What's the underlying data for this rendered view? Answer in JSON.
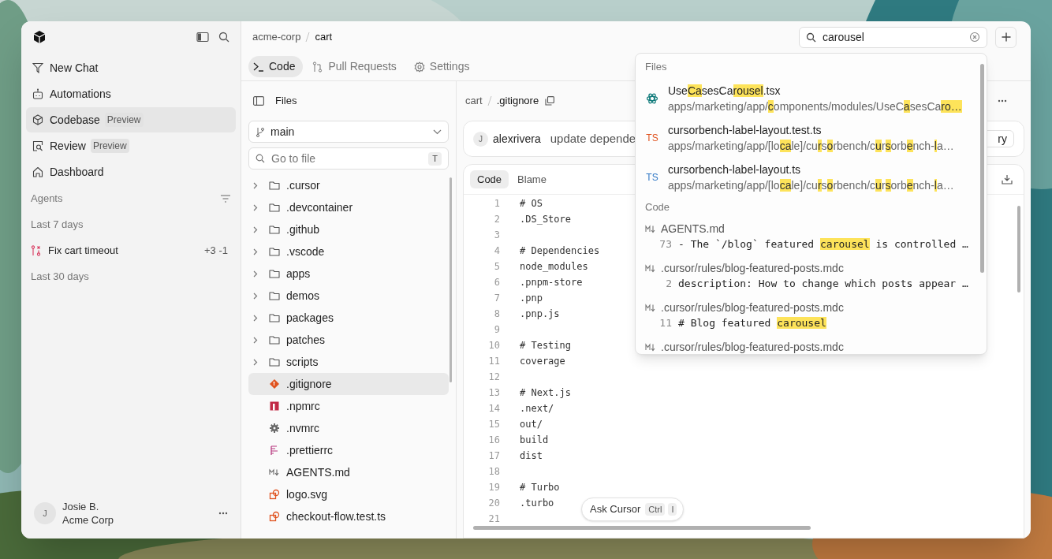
{
  "sidebar": {
    "nav": [
      {
        "label": "New Chat",
        "selected": false
      },
      {
        "label": "Automations",
        "selected": false
      },
      {
        "label": "Codebase",
        "badge": "Preview",
        "selected": true
      },
      {
        "label": "Review",
        "badge": "Preview",
        "selected": false
      },
      {
        "label": "Dashboard",
        "selected": false
      }
    ],
    "agents_heading": "Agents",
    "groups": [
      {
        "label": "Last 7 days",
        "items": [
          {
            "title": "Fix cart timeout",
            "diff": "+3 -1"
          }
        ]
      },
      {
        "label": "Last 30 days"
      }
    ],
    "user": {
      "initial": "J",
      "name": "Josie B.",
      "org": "Acme Corp"
    }
  },
  "breadcrumb": [
    "acme-corp",
    "cart"
  ],
  "tabs": [
    {
      "label": "Code",
      "selected": true
    },
    {
      "label": "Pull Requests",
      "selected": false
    },
    {
      "label": "Settings",
      "selected": false
    }
  ],
  "search": {
    "value": "carousel"
  },
  "files_panel": {
    "title": "Files",
    "branch": "main",
    "filter_placeholder": "Go to file",
    "shortcut": "T",
    "items": [
      {
        "kind": "folder",
        "name": ".cursor"
      },
      {
        "kind": "folder",
        "name": ".devcontainer"
      },
      {
        "kind": "folder",
        "name": ".github"
      },
      {
        "kind": "folder",
        "name": ".vscode"
      },
      {
        "kind": "folder",
        "name": "apps"
      },
      {
        "kind": "folder",
        "name": "demos"
      },
      {
        "kind": "folder",
        "name": "packages"
      },
      {
        "kind": "folder",
        "name": "patches"
      },
      {
        "kind": "folder",
        "name": "scripts"
      },
      {
        "kind": "git",
        "name": ".gitignore",
        "selected": true
      },
      {
        "kind": "npm",
        "name": ".npmrc",
        "selected": false
      },
      {
        "kind": "config",
        "name": ".nvmrc",
        "selected": false
      },
      {
        "kind": "prettier",
        "name": ".prettierrc",
        "selected": false
      },
      {
        "kind": "markdown",
        "name": "AGENTS.md",
        "selected": false
      },
      {
        "kind": "svg",
        "name": "logo.svg",
        "selected": false
      },
      {
        "kind": "svg",
        "name": "checkout-flow.test.ts",
        "selected": false
      }
    ]
  },
  "viewer": {
    "path": [
      "cart",
      ".gitignore"
    ],
    "commit": {
      "initial": "J",
      "author": "alexrivera",
      "message": "update depende",
      "button": "ry"
    },
    "modes": [
      {
        "label": "Code",
        "selected": true
      },
      {
        "label": "Blame",
        "selected": false
      }
    ],
    "lines": [
      {
        "n": "1",
        "text": "# OS"
      },
      {
        "n": "2",
        "text": ".DS_Store"
      },
      {
        "n": "3"
      },
      {
        "n": "4",
        "text": "# Dependencies"
      },
      {
        "n": "5",
        "text": "node_modules"
      },
      {
        "n": "6",
        "text": ".pnpm-store"
      },
      {
        "n": "7",
        "text": ".pnp"
      },
      {
        "n": "8",
        "text": ".pnp.js"
      },
      {
        "n": "9"
      },
      {
        "n": "10",
        "text": "# Testing"
      },
      {
        "n": "11",
        "text": "coverage"
      },
      {
        "n": "12"
      },
      {
        "n": "13",
        "text": "# Next.js"
      },
      {
        "n": "14",
        "text": ".next/"
      },
      {
        "n": "15",
        "text": "out/"
      },
      {
        "n": "16",
        "text": "build"
      },
      {
        "n": "17",
        "text": "dist"
      },
      {
        "n": "18"
      },
      {
        "n": "19",
        "text": "# Turbo"
      },
      {
        "n": "20",
        "text": ".turbo"
      },
      {
        "n": "21"
      }
    ],
    "ask": {
      "label": "Ask Cursor",
      "keys": [
        "Ctrl",
        "I"
      ]
    }
  },
  "results": {
    "files_heading": "Files",
    "files": [
      {
        "kind": "react",
        "name": [
          "Use",
          "Ca",
          "sesCa",
          "rousel",
          ".tsx"
        ],
        "path": [
          "apps/marketing/app/",
          "c",
          "omponents/modules/UseC",
          "a",
          "sesCa",
          "ro…"
        ]
      },
      {
        "kind": "ts-test",
        "badge": "TS",
        "name": [
          "cursorbench-label-layout.test.ts"
        ],
        "path": [
          "apps/marketing/app/[lo",
          "ca",
          "le]/cu",
          "r",
          "s",
          "o",
          "rbench/c",
          "u",
          "r",
          "s",
          "orb",
          "e",
          "nch-",
          "l",
          "a…"
        ]
      },
      {
        "kind": "ts",
        "badge": "TS",
        "name": [
          "cursorbench-label-layout.ts"
        ],
        "path": [
          "apps/marketing/app/[lo",
          "ca",
          "le]/cu",
          "r",
          "s",
          "o",
          "rbench/c",
          "u",
          "r",
          "s",
          "orb",
          "e",
          "nch-",
          "l",
          "a…"
        ]
      }
    ],
    "code_heading": "Code",
    "code": [
      {
        "file": "AGENTS.md",
        "line": "73",
        "text": [
          "- The `/blog` featured ",
          "carousel",
          " is controlled …"
        ]
      },
      {
        "file": ".cursor/rules/blog-featured-posts.mdc",
        "line": "2",
        "text": [
          "description: How to change which posts appear …"
        ]
      },
      {
        "file": ".cursor/rules/blog-featured-posts.mdc",
        "line": "11",
        "text": [
          "# Blog featured ",
          "carousel"
        ]
      },
      {
        "file": ".cursor/rules/blog-featured-posts.mdc"
      }
    ]
  }
}
